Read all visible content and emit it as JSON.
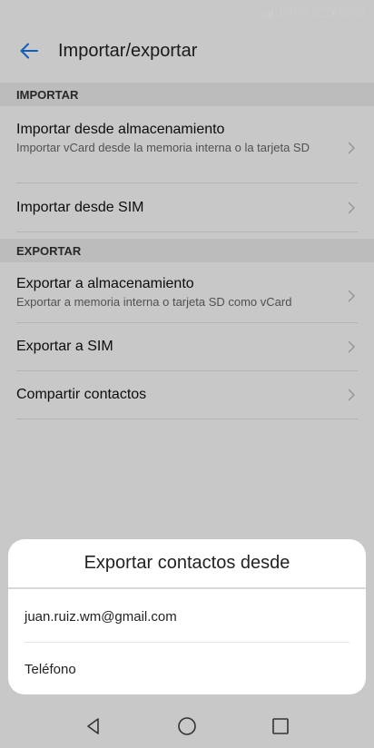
{
  "status": {
    "signal_text": "",
    "battery": "100 %",
    "time": "10:00"
  },
  "header": {
    "title": "Importar/exportar"
  },
  "sections": {
    "import": {
      "label": "IMPORTAR",
      "items": [
        {
          "title": "Importar desde almacenamiento",
          "subtitle": "Importar vCard desde la memoria interna o la tarjeta SD"
        },
        {
          "title": "Importar desde SIM"
        }
      ]
    },
    "export": {
      "label": "EXPORTAR",
      "items": [
        {
          "title": "Exportar a almacenamiento",
          "subtitle": "Exportar a memoria interna o tarjeta SD como vCard"
        },
        {
          "title": "Exportar a SIM"
        },
        {
          "title": "Compartir contactos"
        }
      ]
    }
  },
  "dialog": {
    "title": "Exportar contactos desde",
    "options": [
      "juan.ruiz.wm@gmail.com",
      "Teléfono"
    ]
  },
  "colors": {
    "accent": "#1a73e8",
    "scrim": "rgba(0,0,0,0.2)"
  }
}
